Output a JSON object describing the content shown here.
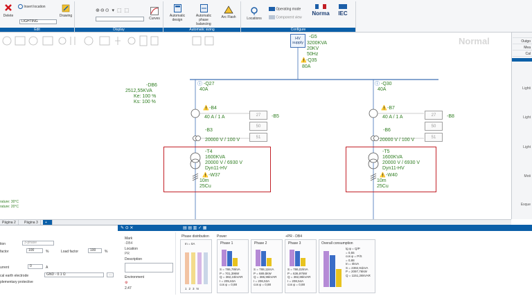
{
  "ribbon": {
    "delete_label": "Delete",
    "insert_location_label": "Insert location",
    "location_value": "LIGHTING",
    "drawing_label": "Drawing",
    "curves_label": "Curves",
    "auto_design_label": "Automatic design",
    "auto_phase_label": "Automatic phase balancing",
    "arc_flash_label": "Arc Flash",
    "locations_label": "Locations",
    "operating_mode_label": "Operating mode",
    "component_view_label": "Component view",
    "norma_label": "Norma",
    "iec_label": "IEC",
    "groups": [
      "Edit",
      "Display",
      "Automatic sizing",
      "Configure"
    ]
  },
  "canvas": {
    "watermark": "Normal",
    "supply": {
      "hv_label": "HV supply",
      "id": "-G5",
      "kva": "3200KVA",
      "kv": "20KV",
      "hz": "50Hz",
      "fuse": "-Q35",
      "fuse_a": "80A"
    },
    "board": {
      "id": "-DB6",
      "kva": "2512,55KVA",
      "ke": "Ke: 100 %",
      "ks": "Ks: 100 %"
    },
    "left": {
      "breaker": "-Q27",
      "breaker_a": "40A",
      "ct": "-B4",
      "ct_rating": "40 A / 1 A",
      "ct_tag": "-B5",
      "vt": "-B3",
      "vt_rating": "20000 V / 100 V",
      "cells": [
        "27",
        "50",
        "51"
      ],
      "transformer": "-T4",
      "t_kva": "1600KVA",
      "t_v": "20000 V / 6930 V",
      "t_group": "Dyn11-HV",
      "cable": "-W37",
      "cable_len": "10m",
      "cable_sec": "25Cu"
    },
    "right": {
      "breaker": "-Q30",
      "breaker_a": "40A",
      "ct": "-B7",
      "ct_rating": "40 A / 1 A",
      "ct_tag": "-B8",
      "vt": "-B6",
      "vt_rating": "20000 V / 100 V",
      "cells": [
        "27",
        "50",
        "51"
      ],
      "transformer": "-T5",
      "t_kva": "1600KVA",
      "t_v": "20000 V / 6930 V",
      "t_group": "Dyn11-HV",
      "cable": "-W40",
      "cable_len": "10m",
      "cable_sec": "25Cu"
    },
    "temp1": "rature: 30°C",
    "temp2": "rature: 20°C"
  },
  "sidebar": {
    "tabs": [
      "Outgo",
      "Mea",
      "Cal"
    ],
    "labels": [
      "Lighti",
      "Light",
      "Light",
      "Moti",
      "Exque"
    ]
  },
  "pagetabs": [
    "Página 2",
    "Página 3"
  ],
  "bottom": {
    "left": {
      "phase_label": "tion",
      "phase_value": "3-phase",
      "factor_label": "factor",
      "factor_value": "100",
      "factor_unit": "%",
      "load_factor_label": "Load factor",
      "load_factor_value": "100",
      "load_factor_unit": "%",
      "current_label": "urrent",
      "current_value": "0",
      "current_unit": "A",
      "earth_label": "cal earth electrode",
      "earth_value": "GND - 0.1 Ω",
      "protective_label": "plementary protective"
    },
    "mid": {
      "mark_label": "Mark",
      "mark_value": "-DB4",
      "location_label": "Location",
      "location_value": "PR",
      "description_label": "Description",
      "environment_label": "Environment",
      "env_value": "2.47"
    },
    "phase_distribution": {
      "title": "Phase distribution",
      "in_label": "In = 0A",
      "axis": [
        "1",
        "2",
        "3",
        "N"
      ]
    },
    "power": {
      "title": "Power",
      "board_label": "+PR - DB4",
      "phases": [
        {
          "name": "Phase 1",
          "s": "S = 786,78kVA",
          "p": "P = 701,39kW",
          "q": "Q = 382,24kVAR",
          "i": "I = 205,63A",
          "cos": "cos φ = 0,88"
        },
        {
          "name": "Phase 2",
          "s": "S = 788,11kVA",
          "p": "P = 689,5kW",
          "q": "Q = 386,96kVAR",
          "i": "I = 206,53A",
          "cos": "cos φ = 0,88"
        },
        {
          "name": "Phase 3",
          "s": "S = 786,02kVA",
          "p": "P = 636,97kW",
          "q": "Q = 382,86kVAR",
          "i": "I = 208,54A",
          "cos": "cos φ = 0,88"
        }
      ],
      "overall": {
        "name": "Overall consumption",
        "tg": "tg φ = Q/P",
        "tg_v": "= 0,55",
        "cos": "cos φ = P/S",
        "cos_v": "= 0,88",
        "in": "In = 0kVA",
        "s": "S = 2392,91kVA",
        "p": "P = 2097,76kW",
        "q": "Q = 1151,26kVAR"
      }
    }
  },
  "colors": {
    "accent": "#0b5fa8",
    "green": "#2f7d21",
    "red": "#c21f26",
    "busbar": "#3f6fb5"
  }
}
